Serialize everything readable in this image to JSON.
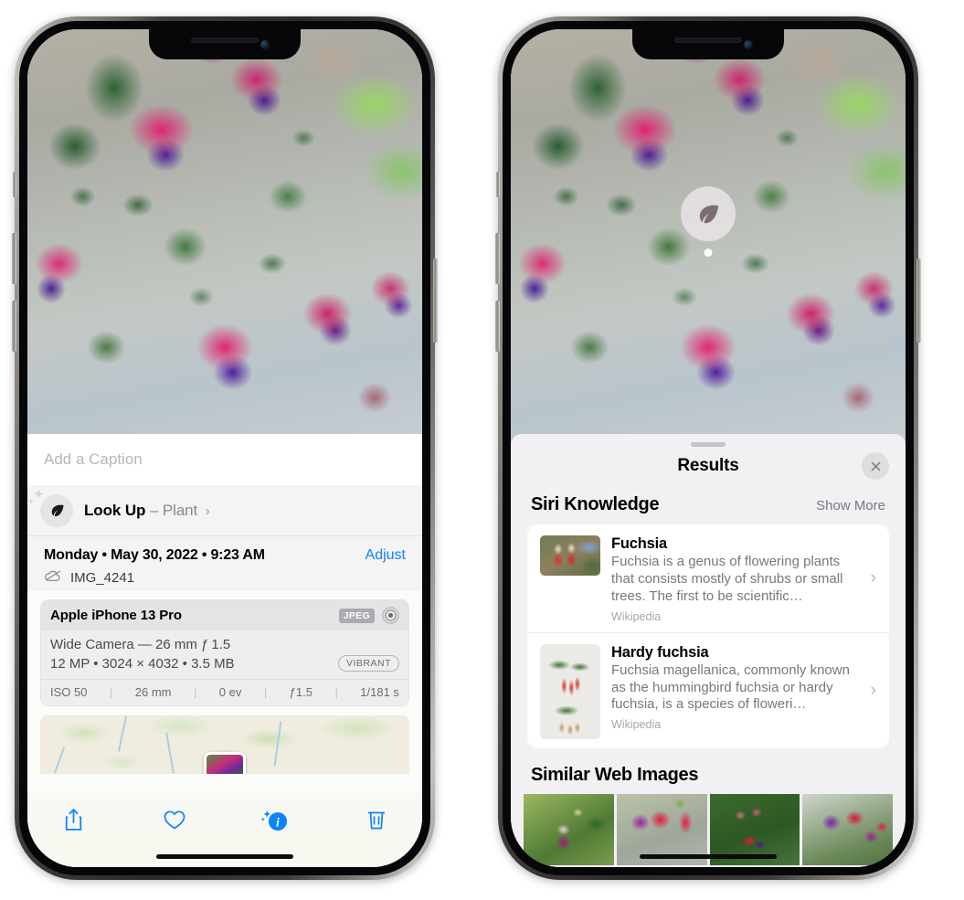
{
  "left_phone": {
    "caption_field": {
      "placeholder": "Add a Caption",
      "value": ""
    },
    "lookup_row": {
      "icon": "leaf-icon",
      "label": "Look Up",
      "dash": "–",
      "subject": "Plant",
      "chevron": "›"
    },
    "meta": {
      "date": "Monday • May 30, 2022 • 9:23 AM",
      "adjust_label": "Adjust",
      "cloud_icon": "cloud-slash-icon",
      "filename": "IMG_4241"
    },
    "camera_card": {
      "model": "Apple iPhone 13 Pro",
      "format_badge": "JPEG",
      "lens_icon": "lens-icon",
      "lens_line": "Wide Camera — 26 mm ƒ 1.5",
      "spec_line": "12 MP • 3024 × 4032 • 3.5 MB",
      "color_badge": "VIBRANT",
      "exif": [
        "ISO 50",
        "26 mm",
        "0 ev",
        "ƒ1.5",
        "1/181 s"
      ]
    },
    "toolbar": [
      {
        "name": "share-button",
        "icon": "share-icon"
      },
      {
        "name": "favorite-button",
        "icon": "heart-icon"
      },
      {
        "name": "info-button",
        "icon": "info-sparkle-icon"
      },
      {
        "name": "delete-button",
        "icon": "trash-icon"
      }
    ]
  },
  "right_phone": {
    "visual_lookup_badge": {
      "icon": "leaf-icon"
    },
    "sheet": {
      "title": "Results",
      "close_icon": "close-icon"
    },
    "siri_knowledge": {
      "section_title": "Siri Knowledge",
      "show_more": "Show More",
      "items": [
        {
          "title": "Fuchsia",
          "description": "Fuchsia is a genus of flowering plants that consists mostly of shrubs or small trees. The first to be scientific…",
          "source": "Wikipedia",
          "chevron": "›"
        },
        {
          "title": "Hardy fuchsia",
          "description": "Fuchsia magellanica, commonly known as the hummingbird fuchsia or hardy fuchsia, is a species of floweri…",
          "source": "Wikipedia",
          "chevron": "›"
        }
      ]
    },
    "similar_web_images": {
      "section_title": "Similar Web Images",
      "count": 4
    }
  },
  "colors": {
    "accent_blue": "#0a84ff",
    "sheet_background": "#f1f1f4",
    "card_background": "#ffffff",
    "secondary_text": "#78787d"
  }
}
